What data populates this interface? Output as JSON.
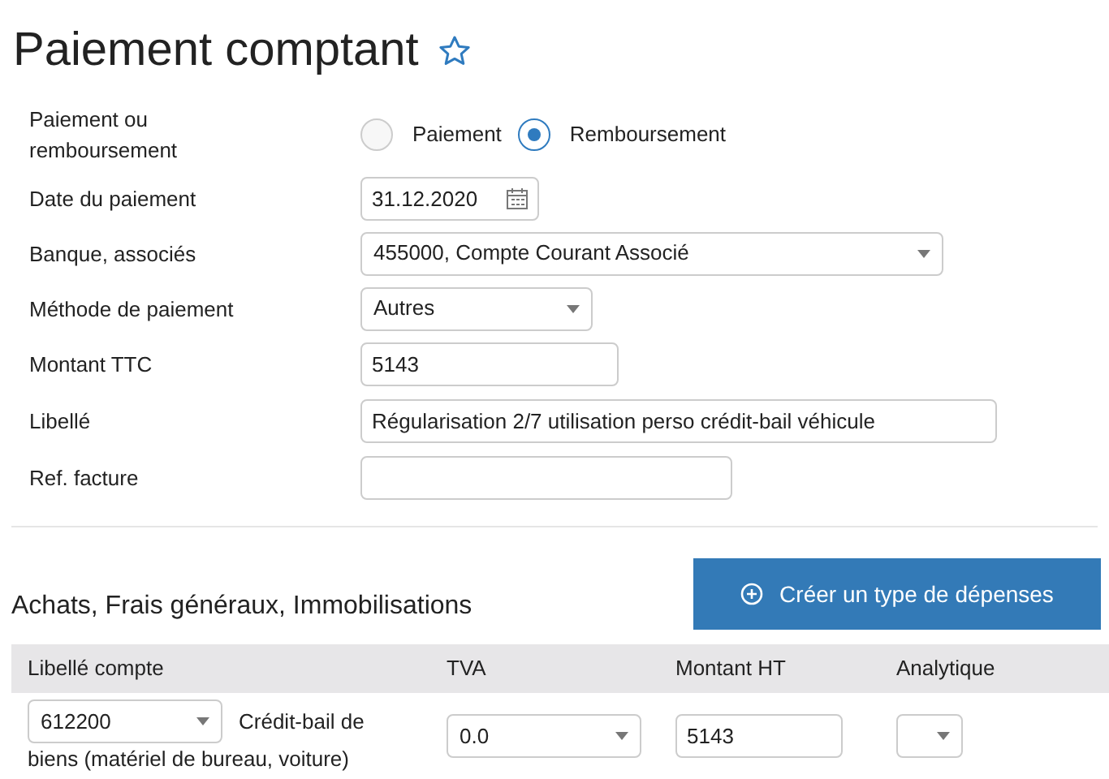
{
  "title": "Paiement comptant",
  "favorite": false,
  "fields": [
    {
      "kind": "radio",
      "label": "Paiement ou remboursement",
      "options": [
        {
          "label": "Paiement",
          "selected": false
        },
        {
          "label": "Remboursement",
          "selected": true
        }
      ]
    },
    {
      "kind": "date",
      "label": "Date du paiement",
      "value": "31.12.2020"
    },
    {
      "kind": "select",
      "label": "Banque, associés",
      "value": "455000, Compte Courant Associé"
    },
    {
      "kind": "select",
      "label": "Méthode de paiement",
      "value": "Autres"
    },
    {
      "kind": "text",
      "label": "Montant TTC",
      "value": "5143"
    },
    {
      "kind": "text",
      "label": "Libellé",
      "value": "Régularisation 2/7 utilisation perso crédit-bail véhicule"
    },
    {
      "kind": "text",
      "label": "Ref. facture"
    }
  ],
  "create_button": "Créer un type de dépenses",
  "section_title": "Achats, Frais généraux, Immobilisations",
  "table": {
    "columns": [
      "Libellé compte",
      "TVA",
      "Montant HT",
      "Analytique"
    ],
    "rows": [
      {
        "account": "612200",
        "account_label_lines": [
          "Crédit-bail de",
          "biens (matériel de bureau, voiture)"
        ],
        "tva": "0.0",
        "amount": "5143"
      }
    ]
  }
}
